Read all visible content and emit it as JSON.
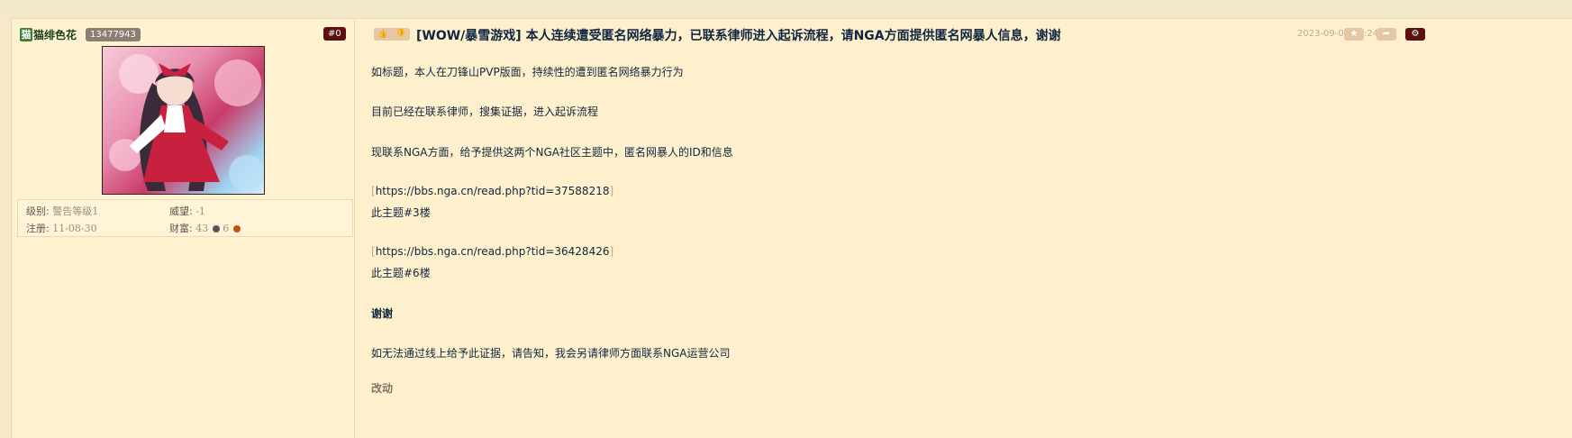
{
  "user": {
    "avatar_char": "猫",
    "name": "猫绯色花",
    "uid": "13477943",
    "level_label": "级别:",
    "level_value": "警告等级1",
    "reputation_label": "威望:",
    "reputation_value": "-1",
    "register_label": "注册:",
    "register_value": "11-08-30",
    "wealth_label": "财富:",
    "wealth_value": "43",
    "wealth_value2": "6"
  },
  "post": {
    "floor": "#0",
    "title": "[WOW/暴雪游戏] 本人连续遭受匿名网络暴力，已联系律师进入起诉流程，请NGA方面提供匿名网暴人信息，谢谢",
    "date": "2023-09-03 09:24",
    "paragraphs": {
      "p1": "如标题，本人在刀锋山PVP版面，持续性的遭到匿名网络暴力行为",
      "p2": "目前已经在联系律师，搜集证据，进入起诉流程",
      "p3": "现联系NGA方面，给予提供这两个NGA社区主题中，匿名网暴人的ID和信息",
      "link1": "https://bbs.nga.cn/read.php?tid=37588218",
      "ref1": "此主题#3楼",
      "link2": "https://bbs.nga.cn/read.php?tid=36428426",
      "ref2": "此主题#6楼",
      "thanks": "谢谢",
      "p4": "如无法通过线上给予此证据，请告知，我会另请律师方面联系NGA运营公司",
      "edit": "改动"
    }
  },
  "icons": {
    "thumb_up": "thumb-up-icon",
    "thumb_down": "thumb-down-icon",
    "star": "star-icon",
    "share": "share-icon",
    "gear": "gear-icon"
  },
  "colors": {
    "page_bg": "#f5e9cc",
    "post_bg": "#fff0cd",
    "accent_dark": "#5b1111",
    "button_tan": "#e7c6a6",
    "uid_badge": "#8a7f72"
  }
}
